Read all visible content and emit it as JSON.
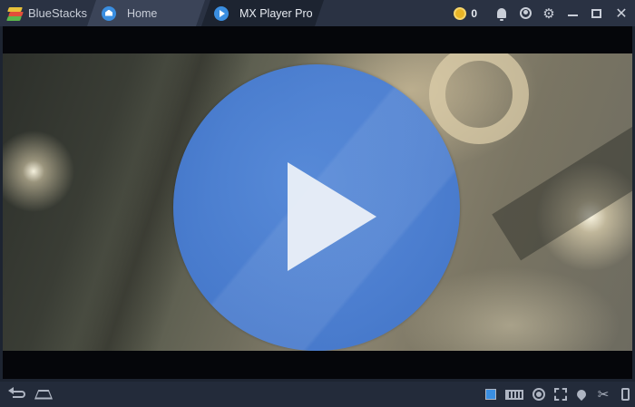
{
  "app": {
    "brand_name": "BlueStacks"
  },
  "tabs": [
    {
      "label": "Home",
      "icon": "home-icon"
    },
    {
      "label": "MX Player Pro",
      "icon": "play-icon"
    }
  ],
  "titlebar_right": {
    "coin_count": "0",
    "icons": [
      "coin-icon",
      "bell-icon",
      "account-icon",
      "gear-icon",
      "minimize-icon",
      "maximize-icon",
      "close-icon"
    ]
  },
  "colors": {
    "accent_blue": "#3a8ee0",
    "play_circle": "#4a7ed8",
    "titlebar": "#2a3243",
    "background": "#1d2431"
  },
  "bottom_bar": {
    "left_icons": [
      "back-icon",
      "home-icon"
    ],
    "right_icons": [
      "keyboard-toggle-icon",
      "keyboard-icon",
      "location-target-icon",
      "fullscreen-icon",
      "location-pin-icon",
      "scissors-icon",
      "phone-rotate-icon"
    ]
  }
}
